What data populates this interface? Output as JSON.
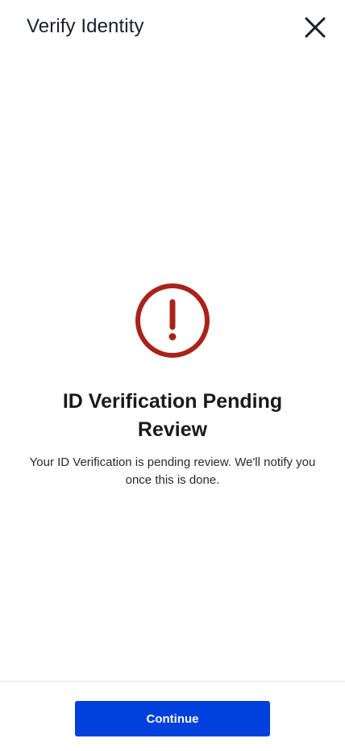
{
  "header": {
    "title": "Verify Identity",
    "close_icon": "close-icon"
  },
  "status": {
    "icon": "alert-icon",
    "icon_color": "#a8231a",
    "title": "ID Verification Pending Review",
    "message": "Your ID Verification is pending review. We'll notify you once this is done."
  },
  "footer": {
    "continue_label": "Continue",
    "button_color": "#0040dd"
  }
}
